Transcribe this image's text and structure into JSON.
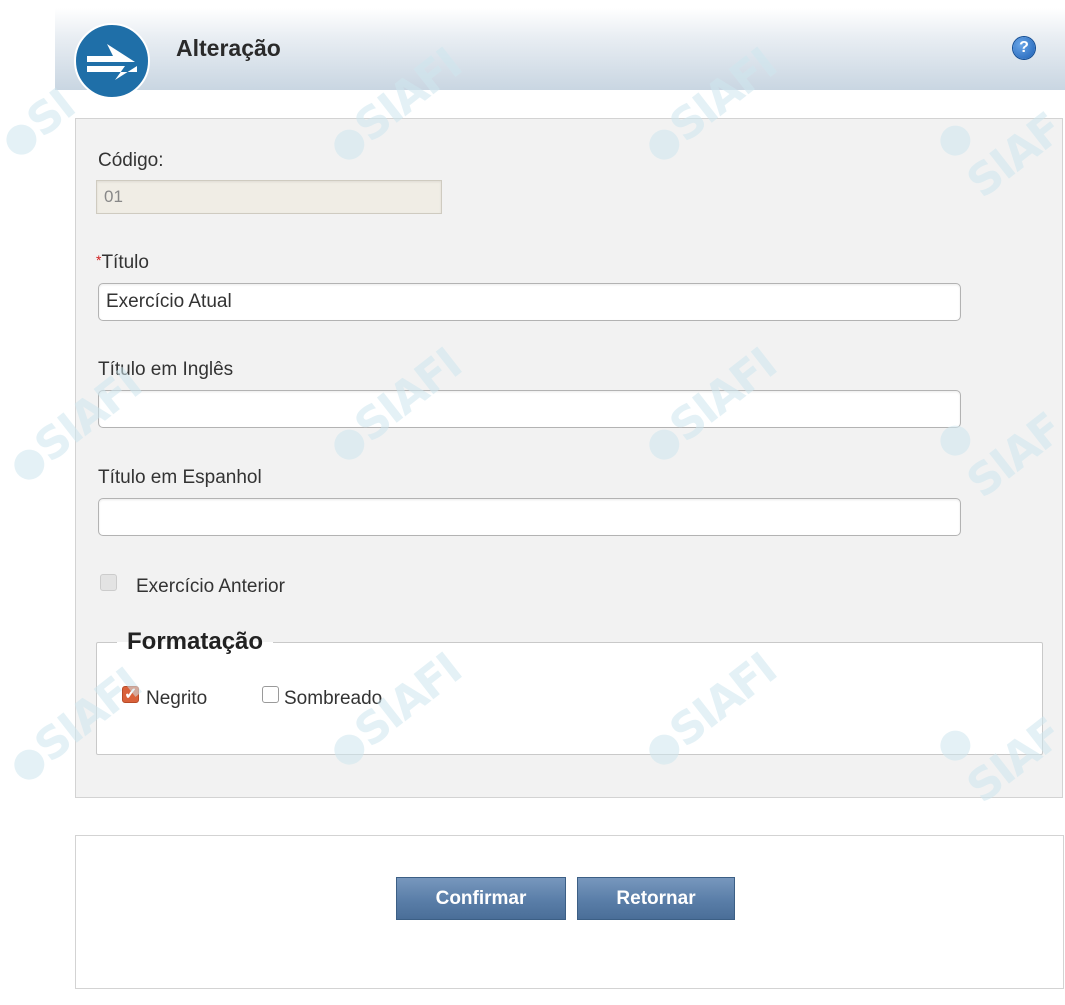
{
  "header": {
    "title": "Alteração",
    "help_icon": "?"
  },
  "form": {
    "codigo": {
      "label": "Código:",
      "value": "01"
    },
    "titulo": {
      "required_mark": "*",
      "label": "Título",
      "value": "Exercício Atual"
    },
    "titulo_ingles": {
      "label": "Título em Inglês",
      "value": ""
    },
    "titulo_espanhol": {
      "label": "Título em Espanhol",
      "value": ""
    },
    "exercicio_anterior": {
      "label": "Exercício Anterior",
      "checked": false,
      "disabled": true
    },
    "formatacao": {
      "legend": "Formatação",
      "negrito": {
        "label": "Negrito",
        "checked": true
      },
      "sombreado": {
        "label": "Sombreado",
        "checked": false
      }
    }
  },
  "buttons": {
    "confirm": "Confirmar",
    "back": "Retornar"
  },
  "watermark": "SIAFI",
  "colors": {
    "accent_button": "#5a7ea8",
    "required": "#d02020",
    "checkbox_checked": "#d9613a"
  }
}
